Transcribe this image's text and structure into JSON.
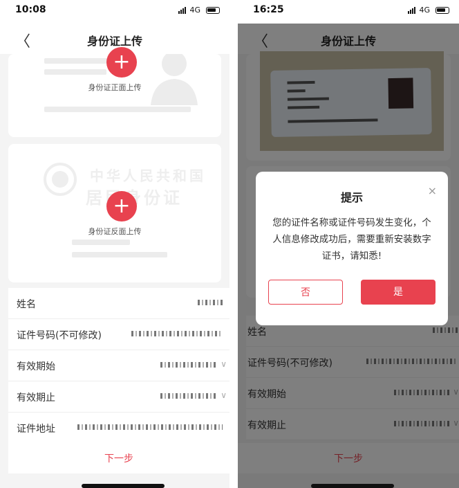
{
  "left": {
    "status": {
      "time": "10:08",
      "net": "4G"
    },
    "nav": {
      "back": "〈",
      "title": "身份证上传"
    },
    "front_upload": {
      "label": "身份证正面上传"
    },
    "back_upload": {
      "label": "身份证反面上传",
      "watermark_line1": "中华人民共和国",
      "watermark_line2": "居民身份证"
    },
    "fields": [
      {
        "label": "姓名"
      },
      {
        "label": "证件号码(不可修改)"
      },
      {
        "label": "有效期始"
      },
      {
        "label": "有效期止"
      },
      {
        "label": "证件地址"
      }
    ],
    "next": "下一步"
  },
  "right": {
    "status": {
      "time": "16:25",
      "net": "4G"
    },
    "nav": {
      "back": "〈",
      "title": "身份证上传"
    },
    "dialog": {
      "title": "提示",
      "close": "×",
      "message": "您的证件名称或证件号码发生变化，个人信息修改成功后，需要重新安装数字证书，请知悉!",
      "no": "否",
      "yes": "是"
    },
    "fields": [
      {
        "label": "姓名"
      },
      {
        "label": "证件号码(不可修改)"
      },
      {
        "label": "有效期始"
      },
      {
        "label": "有效期止"
      }
    ],
    "next": "下一步"
  },
  "colors": {
    "accent": "#e8424f"
  }
}
